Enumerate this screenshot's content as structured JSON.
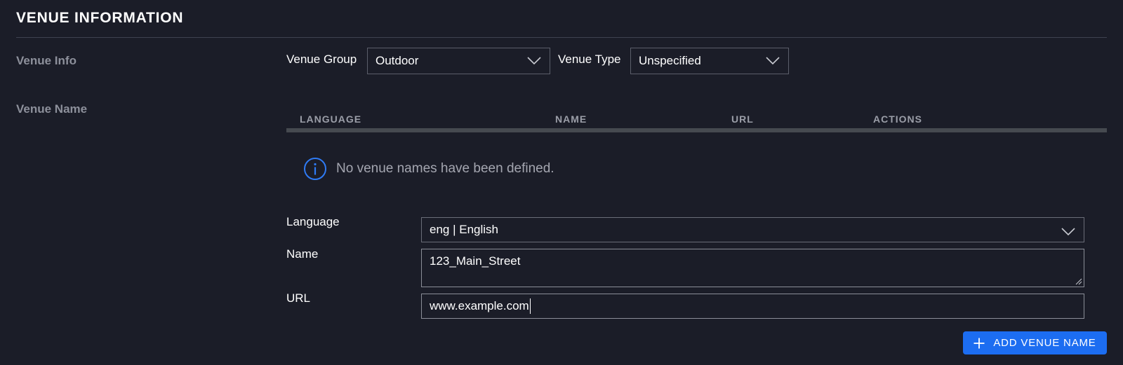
{
  "section": {
    "title": "VENUE INFORMATION"
  },
  "venue_info": {
    "row_label": "Venue Info",
    "group_label": "Venue Group",
    "group_value": "Outdoor",
    "type_label": "Venue Type",
    "type_value": "Unspecified"
  },
  "venue_name": {
    "row_label": "Venue Name",
    "table": {
      "columns": [
        "LANGUAGE",
        "NAME",
        "URL",
        "ACTIONS"
      ],
      "rows": [],
      "empty_message": "No venue names have been defined."
    },
    "form": {
      "language_label": "Language",
      "language_value": "eng | English",
      "name_label": "Name",
      "name_value": "123_Main_Street",
      "url_label": "URL",
      "url_value": "www.example.com"
    },
    "add_button_label": "ADD VENUE NAME"
  },
  "icons": {
    "info": "info-circle-icon",
    "chevron": "chevron-down-icon",
    "plus": "plus-icon",
    "resize": "resize-grip-icon"
  },
  "colors": {
    "background": "#1b1d28",
    "accent": "#1c6df1",
    "muted_text": "#8d909b",
    "divider": "#3f4250"
  }
}
